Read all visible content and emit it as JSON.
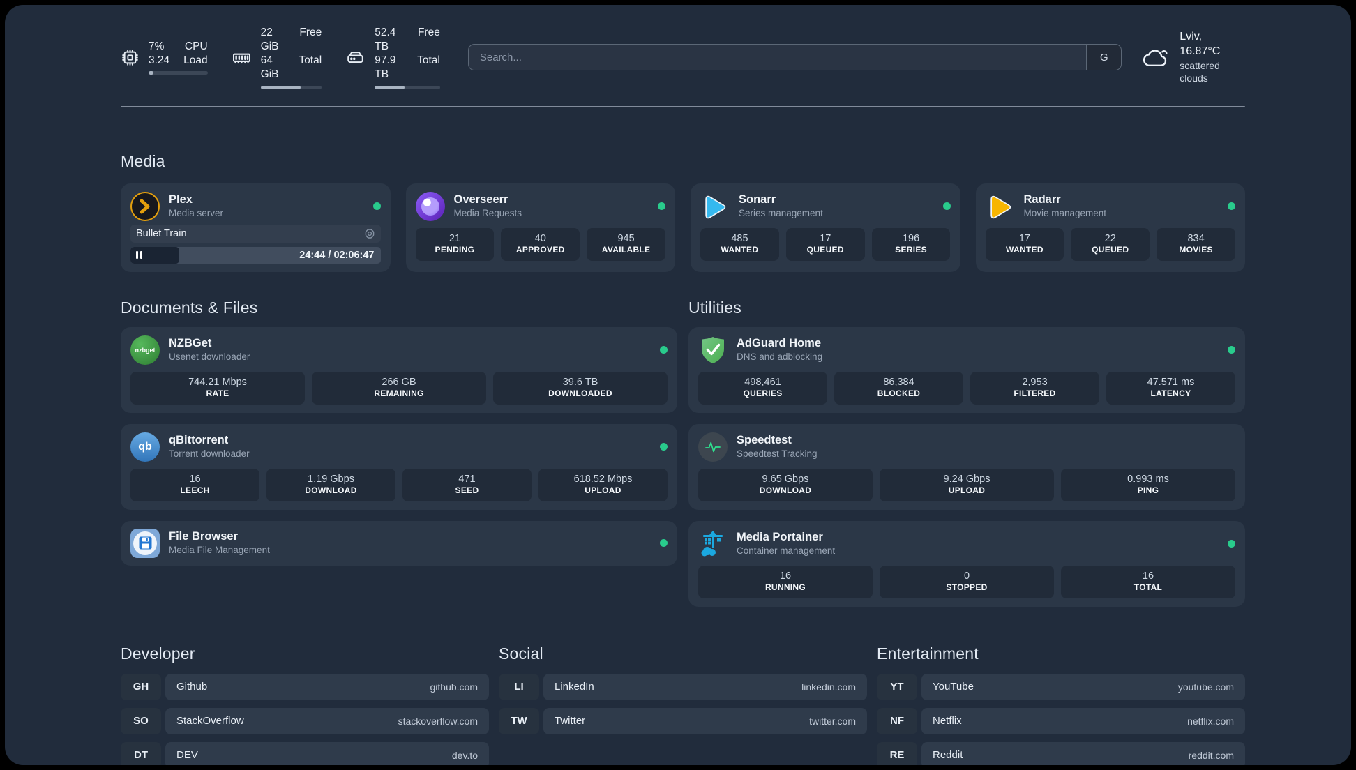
{
  "header": {
    "stats": [
      {
        "icon": "cpu-icon",
        "values": [
          "7%",
          "3.24"
        ],
        "labels": [
          "CPU",
          "Load"
        ],
        "progress_pct": 8
      },
      {
        "icon": "memory-icon",
        "values": [
          "22 GiB",
          "64 GiB"
        ],
        "labels": [
          "Free",
          "Total"
        ],
        "progress_pct": 66
      },
      {
        "icon": "disk-icon",
        "values": [
          "52.4 TB",
          "97.9 TB"
        ],
        "labels": [
          "Free",
          "Total"
        ],
        "progress_pct": 46
      }
    ],
    "search": {
      "placeholder": "Search...",
      "provider_label": "G"
    },
    "weather": {
      "icon": "cloud-icon",
      "summary": "Lviv, 16.87°C",
      "description": "scattered clouds"
    }
  },
  "media": {
    "title": "Media",
    "apps": [
      {
        "icon": "plex-icon",
        "name": "Plex",
        "description": "Media server",
        "online": true,
        "player": {
          "now_playing": "Bullet Train",
          "time_display": "24:44 / 02:06:47",
          "progress_pct": 19.5
        }
      },
      {
        "icon": "overseerr-icon",
        "name": "Overseerr",
        "description": "Media Requests",
        "online": true,
        "stats": [
          {
            "value": "21",
            "label": "PENDING"
          },
          {
            "value": "40",
            "label": "APPROVED"
          },
          {
            "value": "945",
            "label": "AVAILABLE"
          }
        ]
      },
      {
        "icon": "sonarr-icon",
        "name": "Sonarr",
        "description": "Series management",
        "online": true,
        "stats": [
          {
            "value": "485",
            "label": "WANTED"
          },
          {
            "value": "17",
            "label": "QUEUED"
          },
          {
            "value": "196",
            "label": "SERIES"
          }
        ]
      },
      {
        "icon": "radarr-icon",
        "name": "Radarr",
        "description": "Movie management",
        "online": true,
        "stats": [
          {
            "value": "17",
            "label": "WANTED"
          },
          {
            "value": "22",
            "label": "QUEUED"
          },
          {
            "value": "834",
            "label": "MOVIES"
          }
        ]
      }
    ]
  },
  "documents": {
    "title": "Documents & Files",
    "apps": [
      {
        "icon": "nzbget-icon",
        "icon_text": "nzbget",
        "name": "NZBGet",
        "description": "Usenet downloader",
        "online": true,
        "stats": [
          {
            "value": "744.21 Mbps",
            "label": "RATE"
          },
          {
            "value": "266 GB",
            "label": "REMAINING"
          },
          {
            "value": "39.6 TB",
            "label": "DOWNLOADED"
          }
        ]
      },
      {
        "icon": "qbittorrent-icon",
        "icon_text": "qb",
        "name": "qBittorrent",
        "description": "Torrent downloader",
        "online": true,
        "stats": [
          {
            "value": "16",
            "label": "LEECH"
          },
          {
            "value": "1.19 Gbps",
            "label": "DOWNLOAD"
          },
          {
            "value": "471",
            "label": "SEED"
          },
          {
            "value": "618.52 Mbps",
            "label": "UPLOAD"
          }
        ]
      },
      {
        "icon": "filebrowser-icon",
        "name": "File Browser",
        "description": "Media File Management",
        "online": true
      }
    ]
  },
  "utilities": {
    "title": "Utilities",
    "apps": [
      {
        "icon": "adguard-icon",
        "name": "AdGuard Home",
        "description": "DNS and adblocking",
        "online": true,
        "stats": [
          {
            "value": "498,461",
            "label": "QUERIES"
          },
          {
            "value": "86,384",
            "label": "BLOCKED"
          },
          {
            "value": "2,953",
            "label": "FILTERED"
          },
          {
            "value": "47.571 ms",
            "label": "LATENCY"
          }
        ]
      },
      {
        "icon": "speedtest-icon",
        "name": "Speedtest",
        "description": "Speedtest Tracking",
        "online": false,
        "stats": [
          {
            "value": "9.65 Gbps",
            "label": "DOWNLOAD"
          },
          {
            "value": "9.24 Gbps",
            "label": "UPLOAD"
          },
          {
            "value": "0.993 ms",
            "label": "PING"
          }
        ]
      },
      {
        "icon": "portainer-icon",
        "name": "Media Portainer",
        "description": "Container management",
        "online": true,
        "stats": [
          {
            "value": "16",
            "label": "RUNNING"
          },
          {
            "value": "0",
            "label": "STOPPED"
          },
          {
            "value": "16",
            "label": "TOTAL"
          }
        ]
      }
    ]
  },
  "bookmarks": [
    {
      "title": "Developer",
      "links": [
        {
          "abbr": "GH",
          "name": "Github",
          "domain": "github.com"
        },
        {
          "abbr": "SO",
          "name": "StackOverflow",
          "domain": "stackoverflow.com"
        },
        {
          "abbr": "DT",
          "name": "DEV",
          "domain": "dev.to"
        }
      ]
    },
    {
      "title": "Social",
      "links": [
        {
          "abbr": "LI",
          "name": "LinkedIn",
          "domain": "linkedin.com"
        },
        {
          "abbr": "TW",
          "name": "Twitter",
          "domain": "twitter.com"
        }
      ]
    },
    {
      "title": "Entertainment",
      "links": [
        {
          "abbr": "YT",
          "name": "YouTube",
          "domain": "youtube.com"
        },
        {
          "abbr": "NF",
          "name": "Netflix",
          "domain": "netflix.com"
        },
        {
          "abbr": "RE",
          "name": "Reddit",
          "domain": "reddit.com"
        }
      ]
    }
  ],
  "colors": {
    "status_online": "#29cb8c",
    "accent_gold": "#e5a00d",
    "portainer_blue": "#1ba8e0",
    "adguard_green": "#4caf50"
  }
}
